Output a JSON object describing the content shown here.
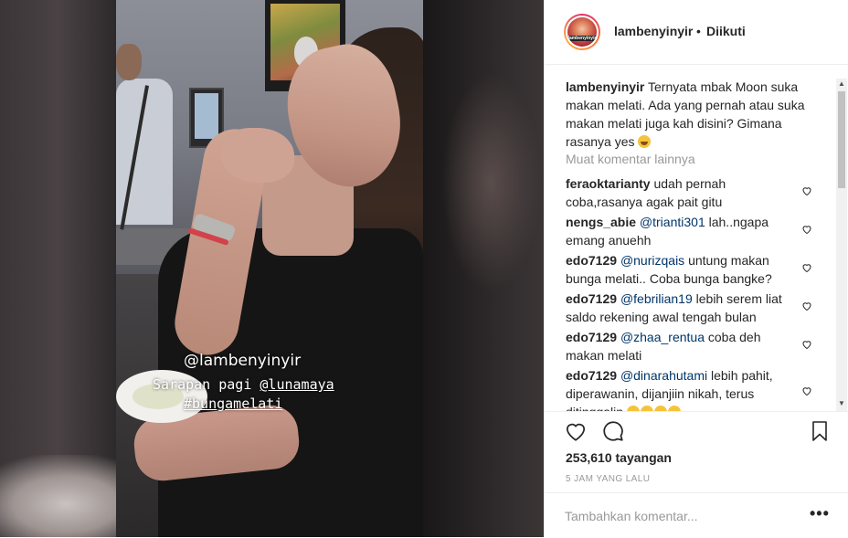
{
  "post": {
    "username": "lambenyinyir",
    "separator": "•",
    "follow_status": "Diikuti",
    "avatar_label": "lambenyinyir"
  },
  "video_overlay": {
    "handle": "@lambenyinyir",
    "line2_prefix": "Sarapan pagi ",
    "line2_mention": "@lunamaya",
    "line3_hashtag": "#bungamelati"
  },
  "caption": {
    "username": "lambenyinyir",
    "text": "Ternyata mbak Moon suka makan melati. Ada yang pernah atau suka makan melati juga kah disini? Gimana rasanya yes",
    "emoji": "grinning-sweat-emoji"
  },
  "load_more": "Muat komentar lainnya",
  "comments": [
    {
      "user": "feraoktarianty",
      "mention": "",
      "text": "udah pernah coba,rasanya agak pait gitu",
      "emojis": 0
    },
    {
      "user": "nengs_abie",
      "mention": "@trianti301",
      "text": "lah..ngapa emang anuehh",
      "emojis": 0
    },
    {
      "user": "edo7129",
      "mention": "@nurizqais",
      "text": "untung makan bunga melati.. Coba bunga bangke?",
      "emojis": 0
    },
    {
      "user": "edo7129",
      "mention": "@febrilian19",
      "text": "lebih serem liat saldo rekening awal tengah bulan",
      "emojis": 0
    },
    {
      "user": "edo7129",
      "mention": "@zhaa_rentua",
      "text": "coba deh makan melati",
      "emojis": 0
    },
    {
      "user": "edo7129",
      "mention": "@dinarahutami",
      "text": "lebih pahit, diperawanin, dijanjiin nikah, terus ditinggalin",
      "emojis": 4
    }
  ],
  "views_count": "253,610",
  "views_label": "tayangan",
  "timestamp": "5 JAM YANG LALU",
  "add_comment_placeholder": "Tambahkan komentar...",
  "more_options": "•••",
  "icons": {
    "like": "heart-icon",
    "comment": "comment-icon",
    "save": "bookmark-icon",
    "comment_like": "heart-icon"
  },
  "colors": {
    "text": "#262626",
    "muted": "#999999",
    "mention": "#003569",
    "border": "#efefef"
  }
}
